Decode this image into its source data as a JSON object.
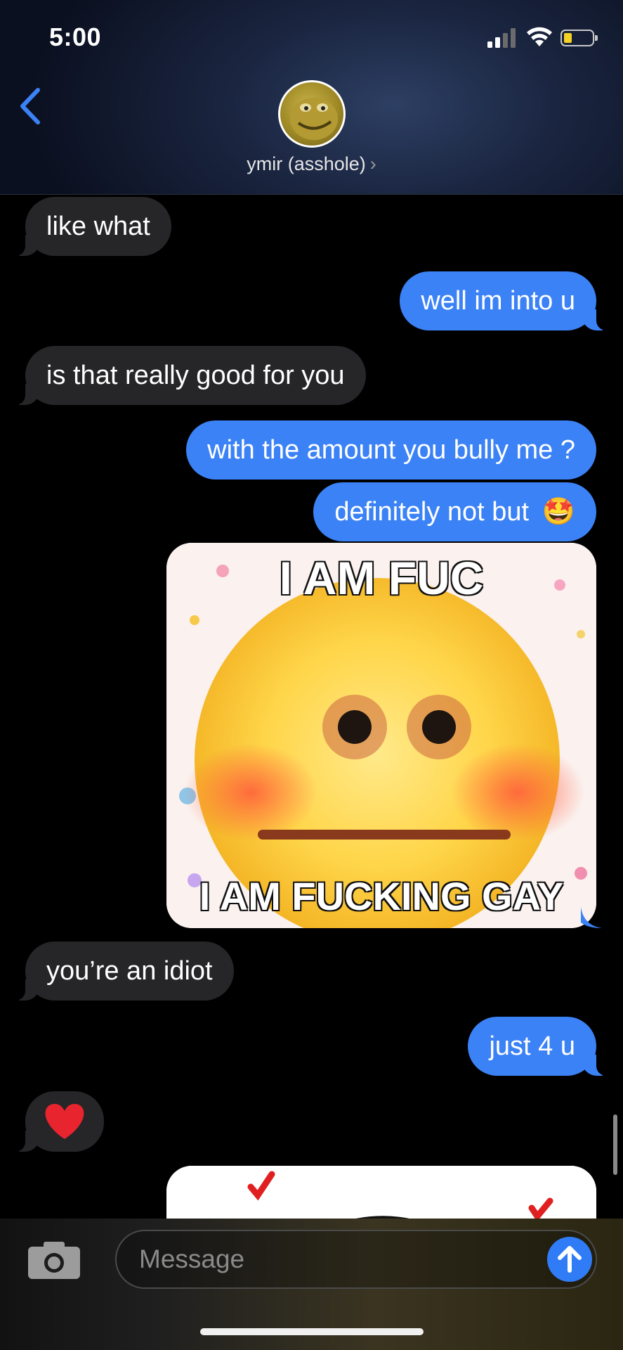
{
  "status_bar": {
    "time": "5:00"
  },
  "header": {
    "contact_name": "ymir (asshole)",
    "chevron": "›"
  },
  "messages": [
    {
      "direction": "incoming",
      "text": "like what"
    },
    {
      "direction": "outgoing",
      "text": "well im into u"
    },
    {
      "direction": "incoming",
      "text": "is that really good for you"
    },
    {
      "direction": "outgoing",
      "text": "with the amount you bully me ?"
    },
    {
      "direction": "outgoing",
      "text": "definitely not but",
      "emoji": "🤩"
    },
    {
      "direction": "outgoing",
      "type": "image",
      "caption_top": "I AM FUC",
      "caption_bottom": "I AM FUCKING GAY"
    },
    {
      "direction": "incoming",
      "text": "you’re an idiot"
    },
    {
      "direction": "outgoing",
      "text": "just 4 u"
    },
    {
      "direction": "incoming",
      "text": "❤️"
    },
    {
      "direction": "outgoing",
      "type": "image"
    }
  ],
  "composer": {
    "placeholder": "Message"
  },
  "colors": {
    "incoming_bubble": "#262628",
    "outgoing_bubble": "#3b82f6",
    "send_button": "#2f7cf6"
  },
  "icons": [
    "back-chevron-icon",
    "signal-icon",
    "wifi-icon",
    "battery-icon",
    "camera-icon",
    "send-arrow-icon"
  ]
}
